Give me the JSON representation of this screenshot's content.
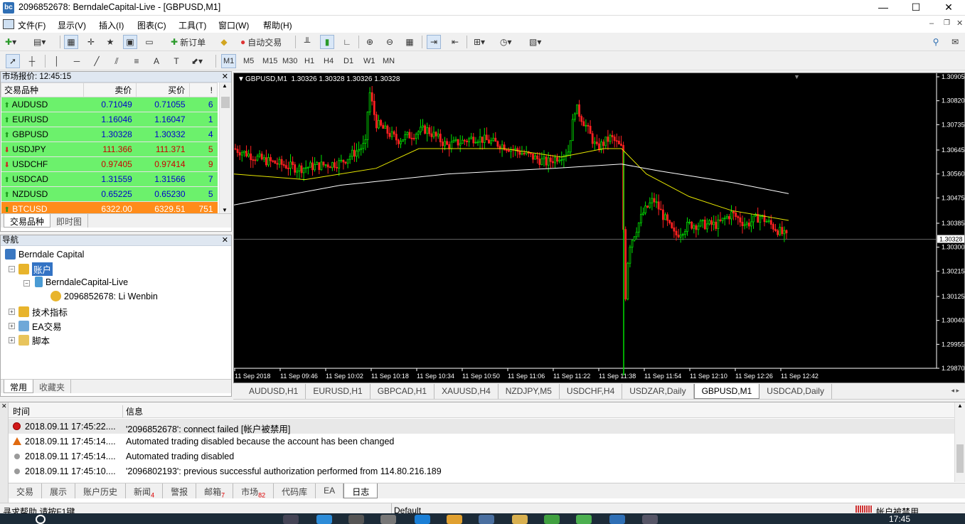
{
  "window": {
    "title": "2096852678: BerndaleCapital-Live - [GBPUSD,M1]",
    "logo": "bc",
    "controls": [
      "—",
      "☐",
      "✕"
    ]
  },
  "menu": [
    "文件(F)",
    "显示(V)",
    "插入(I)",
    "图表(C)",
    "工具(T)",
    "窗口(W)",
    "帮助(H)"
  ],
  "toolbar": {
    "new_order": "新订单",
    "auto_trading": "自动交易"
  },
  "timeframes": [
    "M1",
    "M5",
    "M15",
    "M30",
    "H1",
    "H4",
    "D1",
    "W1",
    "MN"
  ],
  "active_timeframe": "M1",
  "market_watch": {
    "title": "市场报价: 12:45:15",
    "columns": {
      "symbol": "交易品种",
      "bid": "卖价",
      "ask": "买价",
      "spread": "!"
    },
    "rows": [
      {
        "symbol": "AUDUSD",
        "bid": "0.71049",
        "ask": "0.71055",
        "spread": "6",
        "dir": "up",
        "color": "#6cf16c"
      },
      {
        "symbol": "EURUSD",
        "bid": "1.16046",
        "ask": "1.16047",
        "spread": "1",
        "dir": "up",
        "color": "#6cf16c"
      },
      {
        "symbol": "GBPUSD",
        "bid": "1.30328",
        "ask": "1.30332",
        "spread": "4",
        "dir": "up",
        "color": "#6cf16c"
      },
      {
        "symbol": "USDJPY",
        "bid": "111.366",
        "ask": "111.371",
        "spread": "5",
        "dir": "down",
        "color": "#6cf16c"
      },
      {
        "symbol": "USDCHF",
        "bid": "0.97405",
        "ask": "0.97414",
        "spread": "9",
        "dir": "down",
        "color": "#6cf16c"
      },
      {
        "symbol": "USDCAD",
        "bid": "1.31559",
        "ask": "1.31566",
        "spread": "7",
        "dir": "up",
        "color": "#6cf16c"
      },
      {
        "symbol": "NZDUSD",
        "bid": "0.65225",
        "ask": "0.65230",
        "spread": "5",
        "dir": "up",
        "color": "#6cf16c"
      },
      {
        "symbol": "BTCUSD",
        "bid": "6322.00",
        "ask": "6329.51",
        "spread": "751",
        "dir": "up",
        "color": "#ff8c1a"
      }
    ],
    "tabs": [
      "交易品种",
      "即时图"
    ]
  },
  "navigator": {
    "title": "导航",
    "root": "Berndale Capital",
    "accounts": "账户",
    "server": "BerndaleCapital-Live",
    "account": "2096852678: Li Wenbin",
    "indicators": "技术指标",
    "experts": "EA交易",
    "scripts": "脚本",
    "tabs": [
      "常用",
      "收藏夹"
    ]
  },
  "chart": {
    "header": "GBPUSD,M1  1.30326 1.30328 1.30326 1.30328",
    "price_labels": [
      "1.30905",
      "1.30820",
      "1.30735",
      "1.30645",
      "1.30560",
      "1.30475",
      "1.30385",
      "1.30300",
      "1.30215",
      "1.30125",
      "1.30040",
      "1.29955",
      "1.29870"
    ],
    "current_price": "1.30328",
    "time_labels": [
      "11 Sep 2018",
      "11 Sep 09:46",
      "11 Sep 10:02",
      "11 Sep 10:18",
      "11 Sep 10:34",
      "11 Sep 10:50",
      "11 Sep 11:06",
      "11 Sep 11:22",
      "11 Sep 11:38",
      "11 Sep 11:54",
      "11 Sep 12:10",
      "11 Sep 12:26",
      "11 Sep 12:42"
    ],
    "tabs": [
      "AUDUSD,H1",
      "EURUSD,H1",
      "GBPCAD,H1",
      "XAUUSD,H4",
      "NZDJPY,M5",
      "USDCHF,H4",
      "USDZAR,Daily",
      "GBPUSD,M1",
      "USDCAD,Daily"
    ],
    "active_tab": "GBPUSD,M1",
    "colors": {
      "bull": "#00e000",
      "bear": "#ff2020",
      "ma_fast": "#e6e600",
      "ma_slow": "#ffffff"
    }
  },
  "terminal": {
    "columns": {
      "time": "时间",
      "message": "信息"
    },
    "rows": [
      {
        "time": "2018.09.11 17:45:22....",
        "message": "'2096852678': connect failed [帐户被禁用]",
        "icon": "error"
      },
      {
        "time": "2018.09.11 17:45:14....",
        "message": "Automated trading disabled because the account has been changed",
        "icon": "warning"
      },
      {
        "time": "2018.09.11 17:45:14....",
        "message": "Automated trading disabled",
        "icon": "info"
      },
      {
        "time": "2018.09.11 17:45:10....",
        "message": "'2096802193': previous successful authorization performed from 114.80.216.189",
        "icon": "info"
      }
    ],
    "tabs": [
      {
        "label": "交易",
        "badge": ""
      },
      {
        "label": "展示",
        "badge": ""
      },
      {
        "label": "账户历史",
        "badge": ""
      },
      {
        "label": "新闻",
        "badge": "4"
      },
      {
        "label": "警报",
        "badge": ""
      },
      {
        "label": "邮箱",
        "badge": "7"
      },
      {
        "label": "市场",
        "badge": "82"
      },
      {
        "label": "代码库",
        "badge": ""
      },
      {
        "label": "EA",
        "badge": ""
      },
      {
        "label": "日志",
        "badge": ""
      }
    ],
    "active_tab": "日志"
  },
  "status": {
    "help": "寻求帮助,请按F1键",
    "profile": "Default",
    "connection": "帐户被禁用"
  },
  "clock": "17:45"
}
